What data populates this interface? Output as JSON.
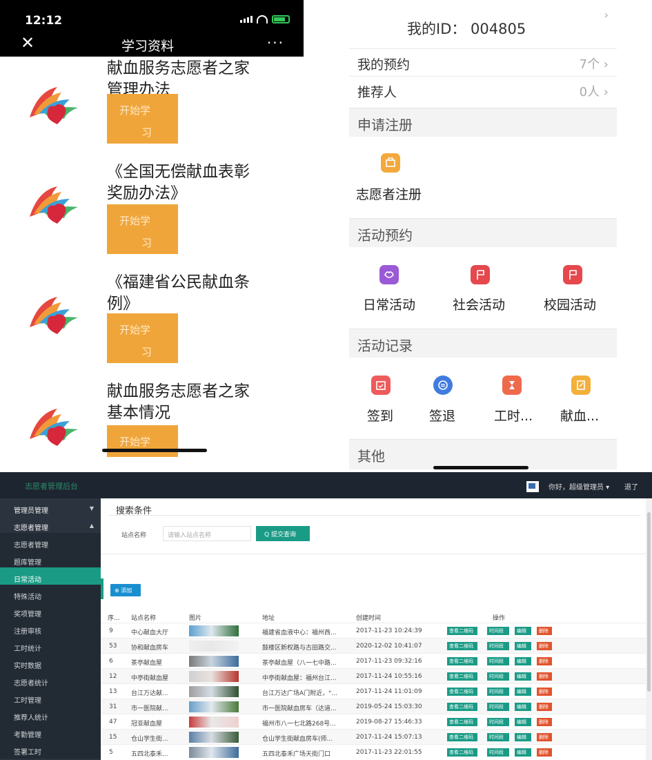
{
  "left_phone": {
    "status_time": "12:12",
    "title": "学习资料",
    "close_label": "✕",
    "more_label": "···",
    "items": [
      {
        "line1": "献血服务志愿者之家",
        "line2": "管理办法",
        "button_l1": "开始学",
        "button_l2": "习"
      },
      {
        "line1": "《全国无偿献血表彰",
        "line2": "奖励办法》",
        "button_l1": "开始学",
        "button_l2": "习"
      },
      {
        "line1": "《福建省公民献血条",
        "line2": "例》",
        "button_l1": "开始学",
        "button_l2": "习"
      },
      {
        "line1": "献血服务志愿者之家",
        "line2": "基本情况",
        "button_l1": "开始学",
        "button_l2": ""
      }
    ]
  },
  "right_phone": {
    "my_id": "我的ID：  004805",
    "rows": [
      {
        "label": "我的预约",
        "value": "7个 ›"
      },
      {
        "label": "推荐人",
        "value": "0人 ›"
      }
    ],
    "sections": {
      "register": "申请注册",
      "booking": "活动预约",
      "records": "活动记录",
      "other": "其他"
    },
    "register_items": [
      {
        "label": "志愿者注册",
        "color": "#f3a93b"
      }
    ],
    "booking_items": [
      {
        "label": "日常活动",
        "color": "#9a5ad6"
      },
      {
        "label": "社会活动",
        "color": "#e5484d"
      },
      {
        "label": "校园活动",
        "color": "#e5484d"
      }
    ],
    "record_items": [
      {
        "label": "签到",
        "color": "#ee5b5b"
      },
      {
        "label": "签退",
        "color": "#3f7be0"
      },
      {
        "label": "工时...",
        "color": "#ee6a4b"
      },
      {
        "label": "献血...",
        "color": "#f3b03b"
      }
    ]
  },
  "admin": {
    "brand": "志愿者管理后台",
    "greeting": "你好，超级管理员 ▾",
    "logout": "退了",
    "sidebar": [
      {
        "label": "管理员管理",
        "type": "group",
        "caret": "▼"
      },
      {
        "label": "志愿者管理",
        "type": "group",
        "caret": "▲"
      },
      {
        "label": "志愿者管理",
        "type": "sub"
      },
      {
        "label": "题库管理",
        "type": "sub"
      },
      {
        "label": "日常活动",
        "type": "active"
      },
      {
        "label": "特殊活动",
        "type": "sub"
      },
      {
        "label": "奖项管理",
        "type": "sub"
      },
      {
        "label": "注册审核",
        "type": "sub"
      },
      {
        "label": "工时统计",
        "type": "sub"
      },
      {
        "label": "实时数据",
        "type": "sub"
      },
      {
        "label": "志愿者统计",
        "type": "sub"
      },
      {
        "label": "工时管理",
        "type": "sub"
      },
      {
        "label": "推荐人统计",
        "type": "sub"
      },
      {
        "label": "考勤管理",
        "type": "sub"
      },
      {
        "label": "签署工时",
        "type": "sub"
      }
    ],
    "search": {
      "title": "搜索条件",
      "station_label": "站点名称",
      "placeholder": "请输入站点名称",
      "query_button": "Q 提交查询"
    },
    "add_button": "⊕ 添加",
    "columns": [
      "序...",
      "站点名称",
      "图片",
      "地址",
      "创建时间",
      "操作"
    ],
    "action_labels": {
      "qr": "查看二维码",
      "time": "时间段",
      "edit": "编辑",
      "del": "删除"
    },
    "rows": [
      {
        "id": "9",
        "name": "中心献血大厅",
        "address": "福建省血液中心：福州西...",
        "created": "2017-11-23 10:24:39"
      },
      {
        "id": "53",
        "name": "协和献血房车",
        "address": "鼓楼区新权路与古田路交...",
        "created": "2020-12-02 10:41:07"
      },
      {
        "id": "6",
        "name": "茶亭献血屋",
        "address": "茶亭献血屋（八一七中路...",
        "created": "2017-11-23 09:32:16"
      },
      {
        "id": "12",
        "name": "中亭街献血屋",
        "address": "中亭街献血屋：福州台江...",
        "created": "2017-11-24 10:55:16"
      },
      {
        "id": "13",
        "name": "台江万达献...",
        "address": "台江万达广场A门附近，\"...",
        "created": "2017-11-24 11:01:09"
      },
      {
        "id": "31",
        "name": "市一医院献...",
        "address": "市一医院献血房车（达道...",
        "created": "2019-05-24 15:03:30"
      },
      {
        "id": "47",
        "name": "冠亚献血屋",
        "address": "福州市八一七北路268号...",
        "created": "2019-08-27 15:46:33"
      },
      {
        "id": "15",
        "name": "仓山学生街...",
        "address": "仓山学生街献血房车(师...",
        "created": "2017-11-24 15:07:13"
      },
      {
        "id": "5",
        "name": "五四北泰禾...",
        "address": "五四北泰禾广场天街门口",
        "created": "2017-11-23 22:01:55"
      }
    ]
  }
}
